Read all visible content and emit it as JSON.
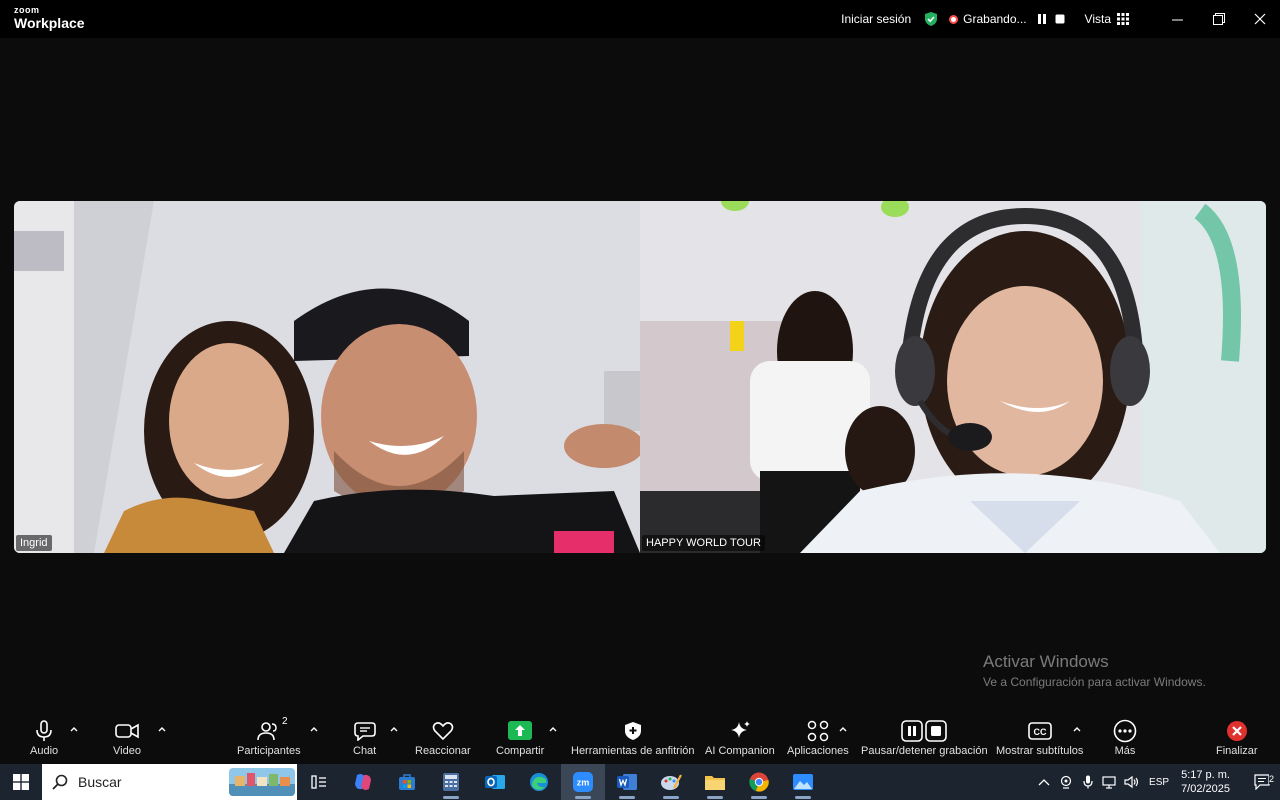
{
  "app": {
    "brand_small": "zoom",
    "brand_big": "Workplace"
  },
  "titlebar": {
    "signin": "Iniciar sesión",
    "recording": "Grabando...",
    "view": "Vista"
  },
  "participants": [
    {
      "name": "Ingrid"
    },
    {
      "name": "HAPPY WORLD TOUR"
    }
  ],
  "watermark": {
    "line1": "Activar Windows",
    "line2": "Ve a Configuración para activar Windows."
  },
  "toolbar": {
    "audio": "Audio",
    "video": "Video",
    "participants": "Participantes",
    "participants_count": "2",
    "chat": "Chat",
    "react": "Reaccionar",
    "share": "Compartir",
    "host_tools": "Herramientas de anfitrión",
    "ai": "AI Companion",
    "apps": "Aplicaciones",
    "pause_stop": "Pausar/detener grabación",
    "captions": "Mostrar subtítulos",
    "more": "Más",
    "end": "Finalizar"
  },
  "taskbar": {
    "search_placeholder": "Buscar",
    "lang": "ESP",
    "time": "5:17 p. m.",
    "date": "7/02/2025",
    "notifications": "2"
  },
  "colors": {
    "share_green": "#1db954",
    "end_red": "#e0312f",
    "secure_green": "#23b160",
    "taskbar_bg": "#1c2430"
  }
}
